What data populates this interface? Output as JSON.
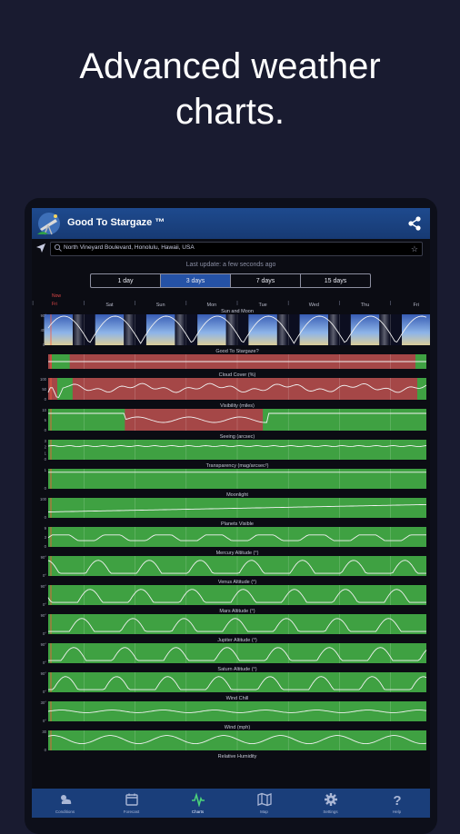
{
  "headline": {
    "line1": "Advanced weather",
    "line2": "charts."
  },
  "app": {
    "title": "Good To Stargaze ™"
  },
  "search": {
    "value": "North Vineyard Boulevard, Honolulu, Hawaii, USA"
  },
  "last_update": "Last update: a few seconds ago",
  "ranges": [
    {
      "label": "1 day",
      "active": false
    },
    {
      "label": "3 days",
      "active": false
    },
    {
      "label": "7 days",
      "active": true
    },
    {
      "label": "15 days",
      "active": false
    }
  ],
  "day_labels": [
    "Fri",
    "Sat",
    "Sun",
    "Mon",
    "Tue",
    "Wed",
    "Thu",
    "Fri"
  ],
  "now_label": "Now",
  "panels": [
    {
      "title": "Sun and Moon",
      "type": "sunmoon",
      "ticks": [
        "90°",
        "45°",
        "0°"
      ]
    },
    {
      "title": "Good To Stargaze?",
      "type": "stargaze",
      "ticks": []
    },
    {
      "title": "Cloud Cover (%)",
      "type": "cloud",
      "ticks": [
        "100",
        "50",
        "0"
      ]
    },
    {
      "title": "Visibility (miles)",
      "type": "visibility",
      "ticks": [
        "10",
        "5",
        "0"
      ]
    },
    {
      "title": "Seeing (arcsec)",
      "type": "seeing",
      "ticks": [
        "3",
        "2",
        "1",
        "0"
      ]
    },
    {
      "title": "Transparency (mag/arcsec²)",
      "type": "flat",
      "ticks": [
        "1",
        "0"
      ]
    },
    {
      "title": "Moonlight",
      "type": "moonlight",
      "ticks": [
        "100",
        "0"
      ]
    },
    {
      "title": "Planets Visible",
      "type": "planets",
      "ticks": [
        "9",
        "3",
        "0"
      ]
    },
    {
      "title": "Mercury Altitude (°)",
      "type": "altitude",
      "ticks": [
        "90°",
        "0°"
      ]
    },
    {
      "title": "Venus Altitude (°)",
      "type": "altitude",
      "ticks": [
        "90°",
        "0°"
      ]
    },
    {
      "title": "Mars Altitude (°)",
      "type": "altitude",
      "ticks": [
        "90°",
        "0°"
      ]
    },
    {
      "title": "Jupiter Altitude (°)",
      "type": "altitude",
      "ticks": [
        "90°",
        "0°"
      ]
    },
    {
      "title": "Saturn Altitude (°)",
      "type": "altitude",
      "ticks": [
        "90°",
        "0°"
      ]
    },
    {
      "title": "Wind Chill",
      "type": "windchill",
      "ticks": [
        "30°",
        "0°"
      ]
    },
    {
      "title": "Wind (mph)",
      "type": "wind",
      "ticks": [
        "30",
        "0"
      ]
    },
    {
      "title": "Relative Humidity",
      "type": "none",
      "ticks": []
    }
  ],
  "nav": [
    {
      "label": "Conditions",
      "icon": "weather-icon",
      "active": false
    },
    {
      "label": "Forecast",
      "icon": "calendar-icon",
      "active": false
    },
    {
      "label": "Charts",
      "icon": "charts-icon",
      "active": true
    },
    {
      "label": "Map",
      "icon": "map-icon",
      "active": false
    },
    {
      "label": "Settings",
      "icon": "gear-icon",
      "active": false
    },
    {
      "label": "Help",
      "icon": "help-icon",
      "active": false
    }
  ],
  "colors": {
    "green": "#3fa142",
    "red": "#a54747",
    "accent": "#2552a6",
    "appbar": "#1e4a8e"
  }
}
